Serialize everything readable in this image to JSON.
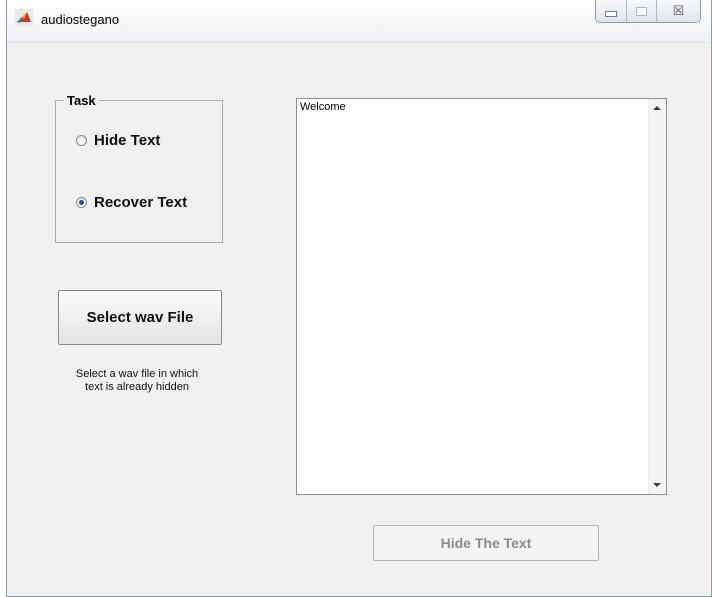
{
  "window": {
    "title": "audiostegano",
    "controls": {
      "close_glyph": "☒"
    }
  },
  "task_group": {
    "legend": "Task",
    "options": [
      {
        "label": "Hide Text",
        "selected": false
      },
      {
        "label": "Recover Text",
        "selected": true
      }
    ]
  },
  "select_button": {
    "label": "Select wav File"
  },
  "hint": {
    "line1": "Select a wav file in which",
    "line2": "text is already hidden"
  },
  "textbox": {
    "content": "Welcome"
  },
  "hide_button": {
    "label": "Hide The Text",
    "enabled": false
  },
  "colors": {
    "window_bg": "#f0f0f0",
    "radio_selected": "#1f4f8f",
    "disabled_text": "#8c8c8c"
  },
  "icons": [
    "matlab-icon",
    "minimize-icon",
    "maximize-icon",
    "close-icon",
    "scroll-up-arrow-icon",
    "scroll-down-arrow-icon"
  ]
}
